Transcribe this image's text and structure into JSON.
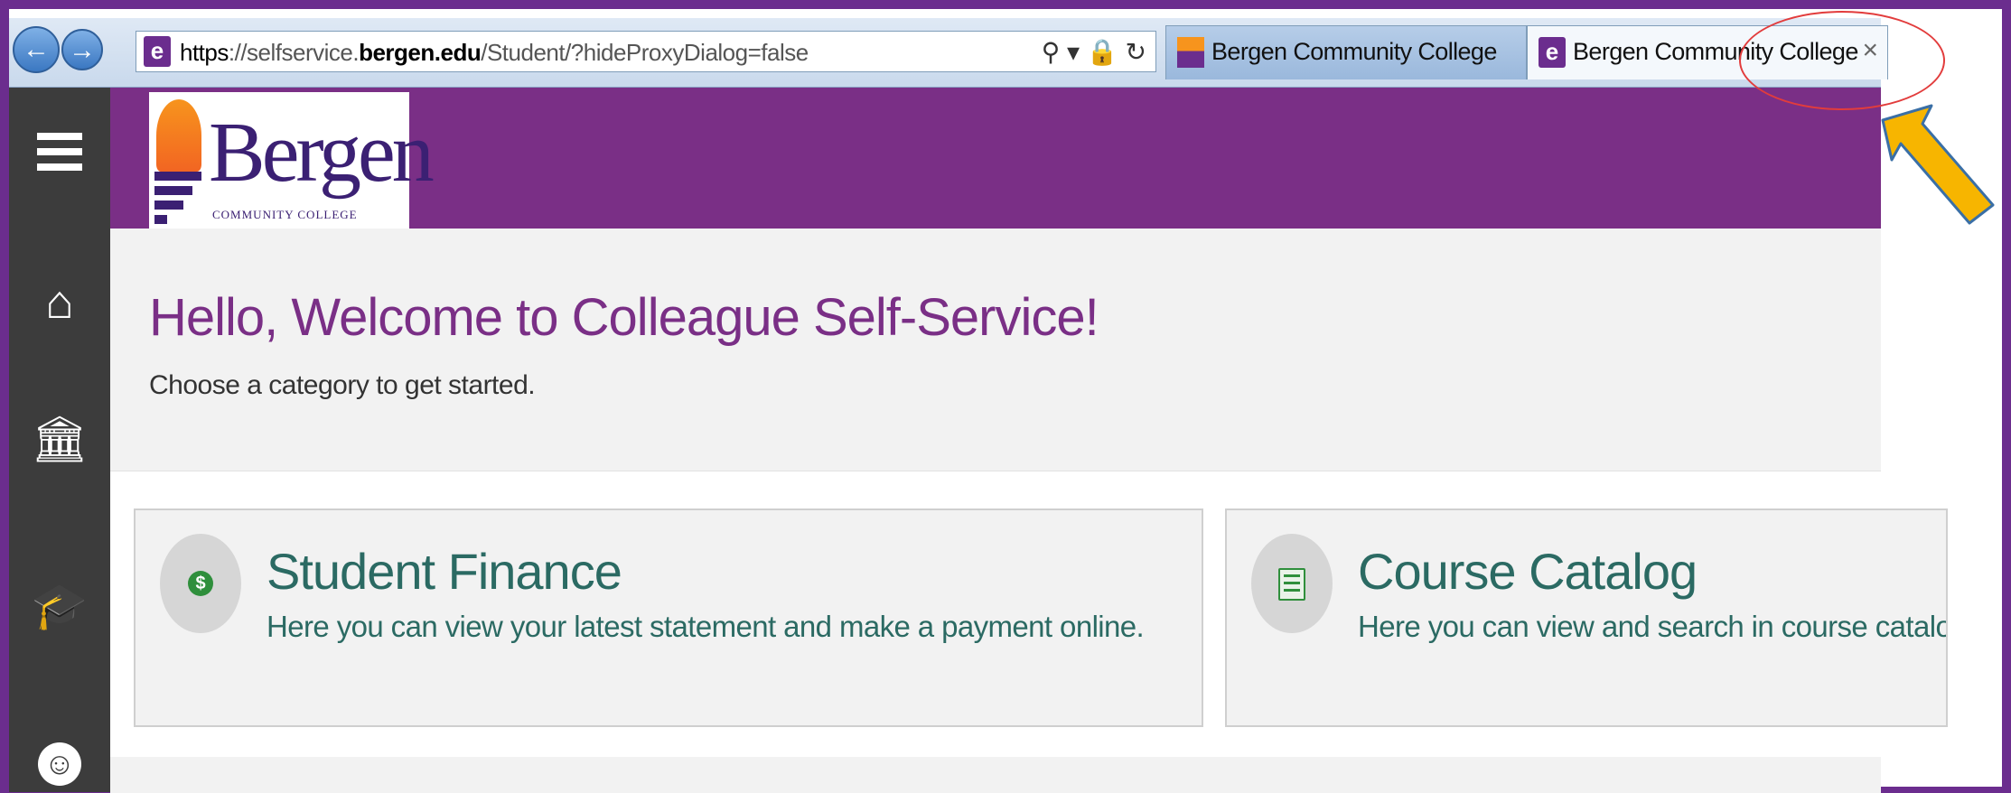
{
  "browser": {
    "url": {
      "scheme": "https",
      "sep": "://",
      "pre": "selfservice.",
      "domain": "bergen.edu",
      "path": "/Student/?hideProxyDialog=false"
    },
    "address_icons": "⚲ ▾ 🔒 ↻",
    "tabs": [
      {
        "label": "Bergen Community College",
        "active": false
      },
      {
        "label": "Bergen Community College",
        "active": true,
        "close": "×"
      }
    ]
  },
  "header": {
    "logo": {
      "word": "Bergen",
      "sub": "COMMUNITY COLLEGE"
    }
  },
  "sidebar": {
    "icons": [
      "menu-icon",
      "home-icon",
      "bank-icon",
      "graduation-cap-icon",
      "user-icon"
    ]
  },
  "main": {
    "title": "Hello, Welcome to Colleague Self-Service!",
    "subtitle": "Choose a category to get started."
  },
  "cards": [
    {
      "title": "Student Finance",
      "description": "Here you can view your latest statement and make a payment online.",
      "icon": "dollar-icon"
    },
    {
      "title": "Course Catalog",
      "description": "Here you can view and search in course catalog.",
      "icon": "book-icon"
    }
  ],
  "colors": {
    "frame": "#6b2d8e",
    "header": "#7a2f86",
    "title": "#7a2f86",
    "card_text": "#2b6a63",
    "sidebar": "#3c3c3c",
    "arrow": "#f7b500",
    "oval": "#e23c3c"
  }
}
